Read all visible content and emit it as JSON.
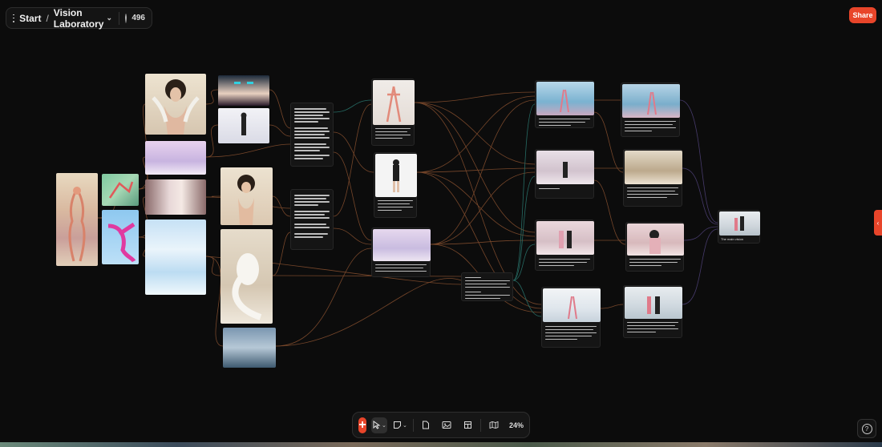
{
  "header": {
    "breadcrumb_start": "Start",
    "breadcrumb_sep": "/",
    "project_name": "Vision Laboratory",
    "credits": "496"
  },
  "share_label": "Share",
  "toolbar": {
    "zoom": "24%"
  },
  "nodes": {
    "final_result_label": "The main vision"
  },
  "colors": {
    "accent": "#e8452a",
    "background": "#0c0c0c",
    "edge_orange": "#9a5a34",
    "edge_teal": "#2f8a80",
    "edge_purple": "#5a4a8a"
  },
  "icons": [
    "menu-icon",
    "chevron-down-icon",
    "credits-icon",
    "plus-icon",
    "cursor-icon",
    "sticky-note-icon",
    "document-icon",
    "image-icon",
    "layout-icon",
    "map-icon",
    "help-icon",
    "chevron-left-icon"
  ]
}
